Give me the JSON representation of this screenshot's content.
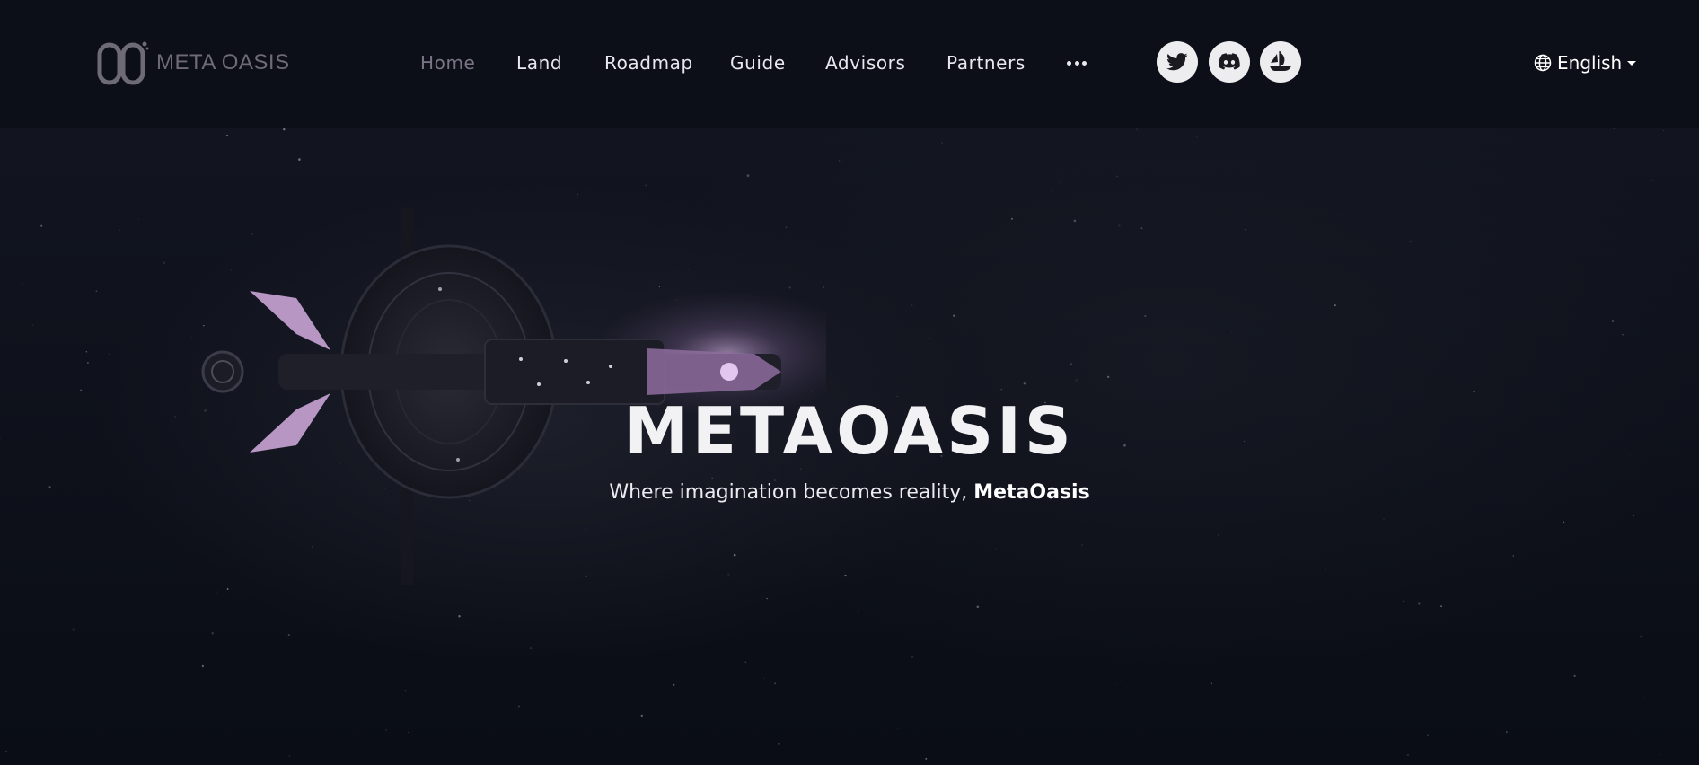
{
  "header": {
    "logo_text": "META OASIS",
    "nav": [
      {
        "label": "Home",
        "active": true
      },
      {
        "label": "Land"
      },
      {
        "label": "Roadmap"
      },
      {
        "label": "Guide"
      },
      {
        "label": "Advisors"
      },
      {
        "label": "Partners"
      }
    ],
    "more_icon": "ellipsis-icon",
    "social": [
      {
        "name": "twitter",
        "icon": "twitter-icon"
      },
      {
        "name": "discord",
        "icon": "discord-icon"
      },
      {
        "name": "opensea",
        "icon": "opensea-icon"
      }
    ],
    "language": {
      "label": "English",
      "icon": "globe-icon"
    }
  },
  "hero": {
    "title": "METAOASIS",
    "subtitle_text": "Where imagination becomes reality, ",
    "subtitle_emphasis": "MetaOasis"
  },
  "colors": {
    "background": "#0b0e16",
    "header_bg": "#0c0f18",
    "nav_text": "#e8e8ee",
    "nav_active": "#7a7486",
    "social_bg": "#ededf0",
    "accent_pink": "#c9a2d6"
  }
}
